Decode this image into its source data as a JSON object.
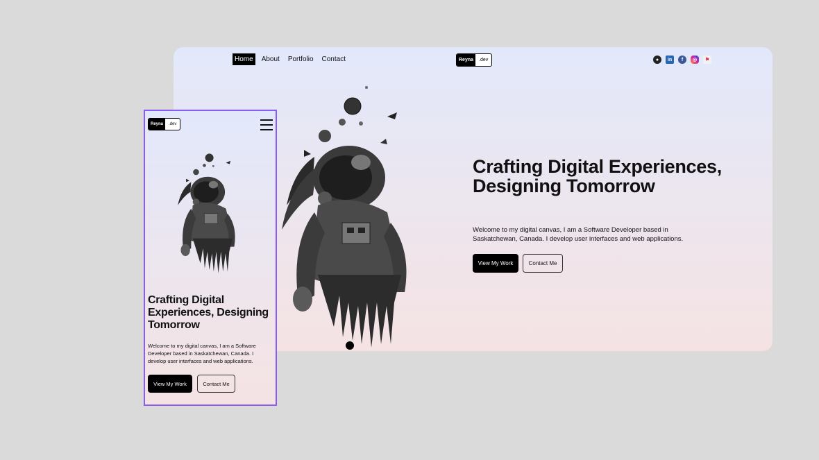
{
  "desktop": {
    "nav": [
      "Home",
      "About",
      "Portfolio",
      "Contact"
    ],
    "active_nav": "Home",
    "logo": {
      "part1": "Reyna",
      "part2": ".dev"
    },
    "socials": [
      "github-icon",
      "linkedin-icon",
      "facebook-icon",
      "instagram-icon",
      "devpost-icon"
    ],
    "socials_glyphs": {
      "gh": "●",
      "li": "in",
      "fb": "f",
      "ig": "◎",
      "dv": "⚑"
    },
    "headline": "Crafting Digital Experiences, Designing Tomorrow",
    "intro": "Welcome to my digital canvas, I am a Software Developer based in Saskatchewan, Canada. I develop user interfaces and web applications.",
    "cta_primary": "View My Work",
    "cta_secondary": "Contact Me"
  },
  "mobile": {
    "logo": {
      "part1": "Reyna",
      "part2": ".dev"
    },
    "headline": "Crafting Digital Experiences, Designing Tomorrow",
    "intro": "Welcome to my digital canvas, I am a Software Developer based in Saskatchewan, Canada. I develop user interfaces and web applications.",
    "cta_primary": "View My Work",
    "cta_secondary": "Contact Me"
  },
  "colors": {
    "background": "#dadada",
    "gradient_top": "#e2e8fb",
    "gradient_bottom": "#f5e3e3",
    "mobile_frame_border": "#8a5cf6",
    "button_dark": "#000000"
  }
}
